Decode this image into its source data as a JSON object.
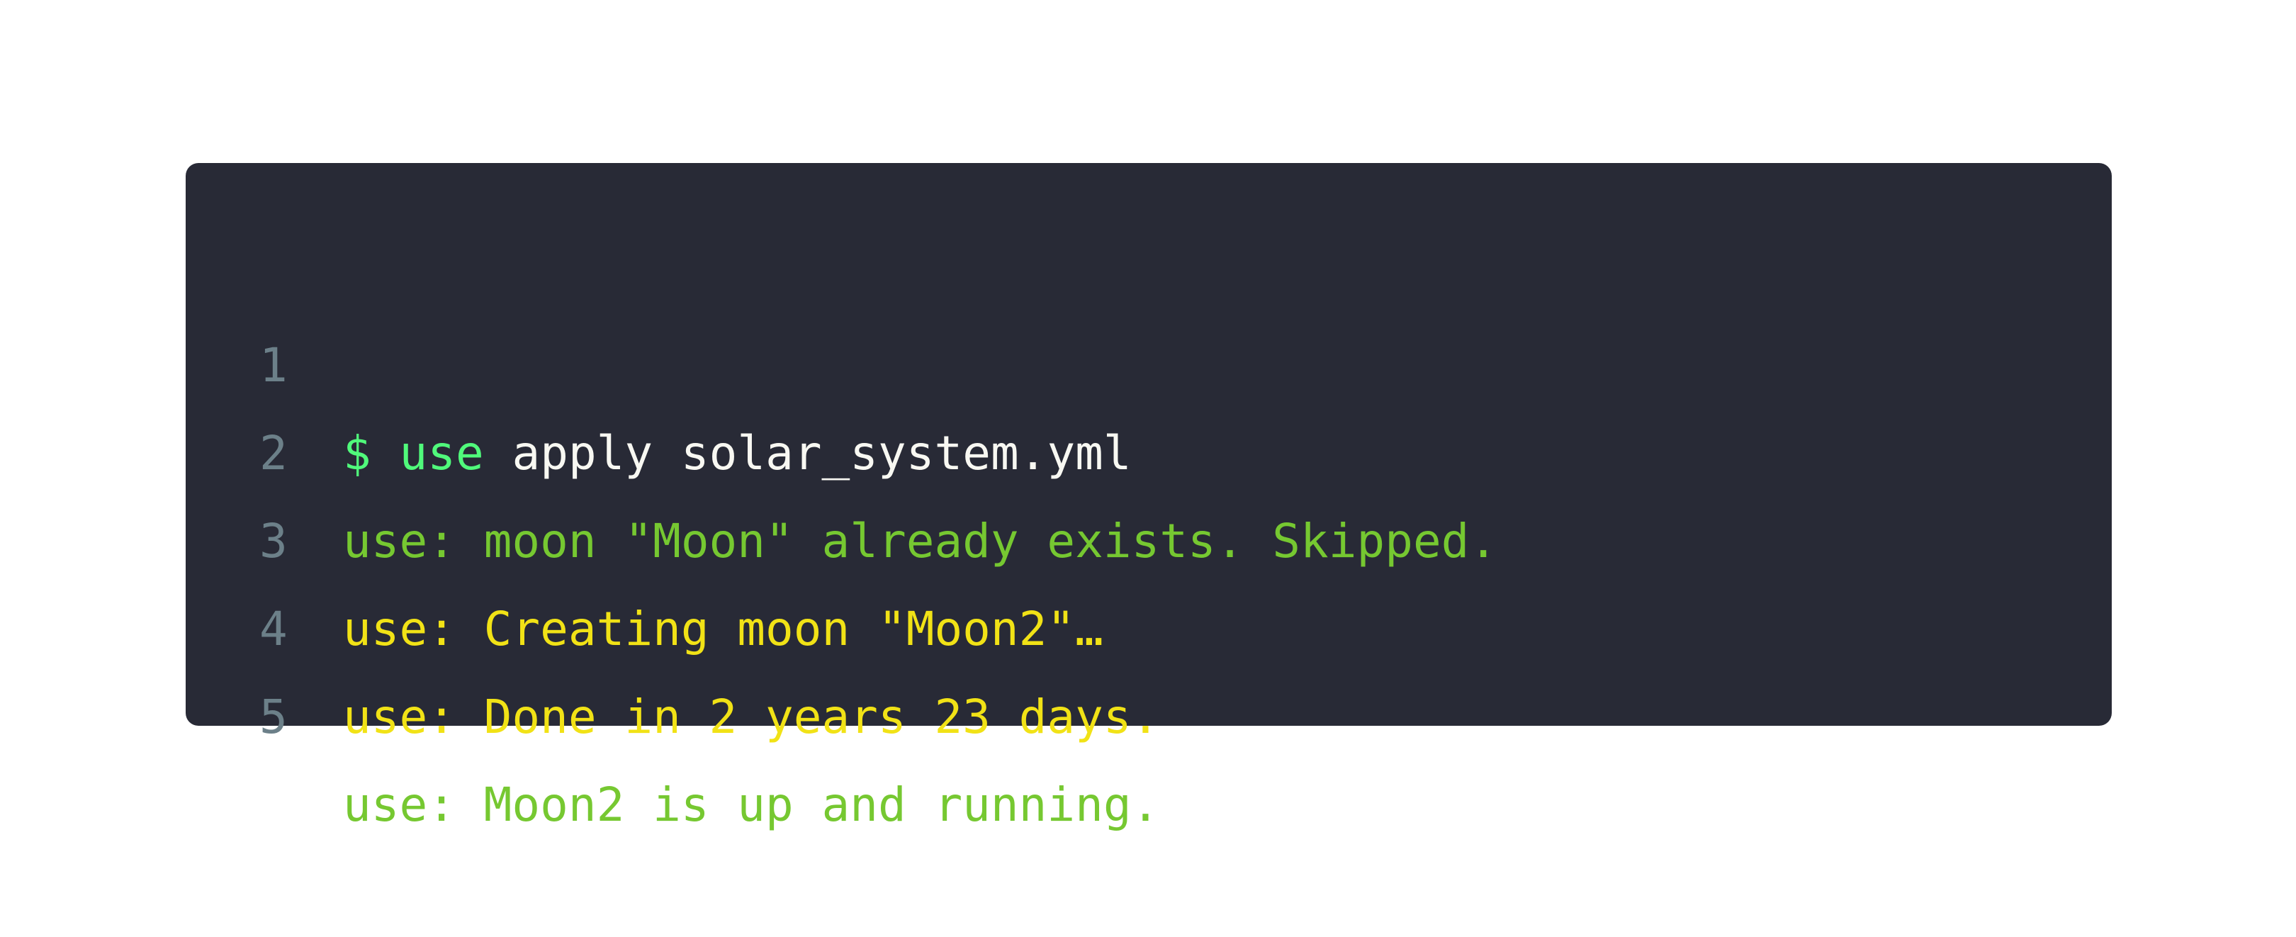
{
  "colors": {
    "background": "#ffffff",
    "code_background": "#282a36",
    "line_number": "#6c8089",
    "prompt": "#50fa7b",
    "command_text": "#f8f8f2",
    "success": "#76c831",
    "progress": "#f1e216"
  },
  "code_lines": [
    {
      "number": "1",
      "prompt": "$",
      "command": "use",
      "arguments": "apply solar_system.yml"
    },
    {
      "number": "2",
      "text": "use: moon \"Moon\" already exists. Skipped.",
      "color": "#76c831"
    },
    {
      "number": "3",
      "text": "use: Creating moon \"Moon2\"…",
      "color": "#f1e216"
    },
    {
      "number": "4",
      "text": "use: Done in 2 years 23 days.",
      "color": "#f1e216"
    },
    {
      "number": "5",
      "text": "use: Moon2 is up and running.",
      "color": "#76c831"
    }
  ]
}
